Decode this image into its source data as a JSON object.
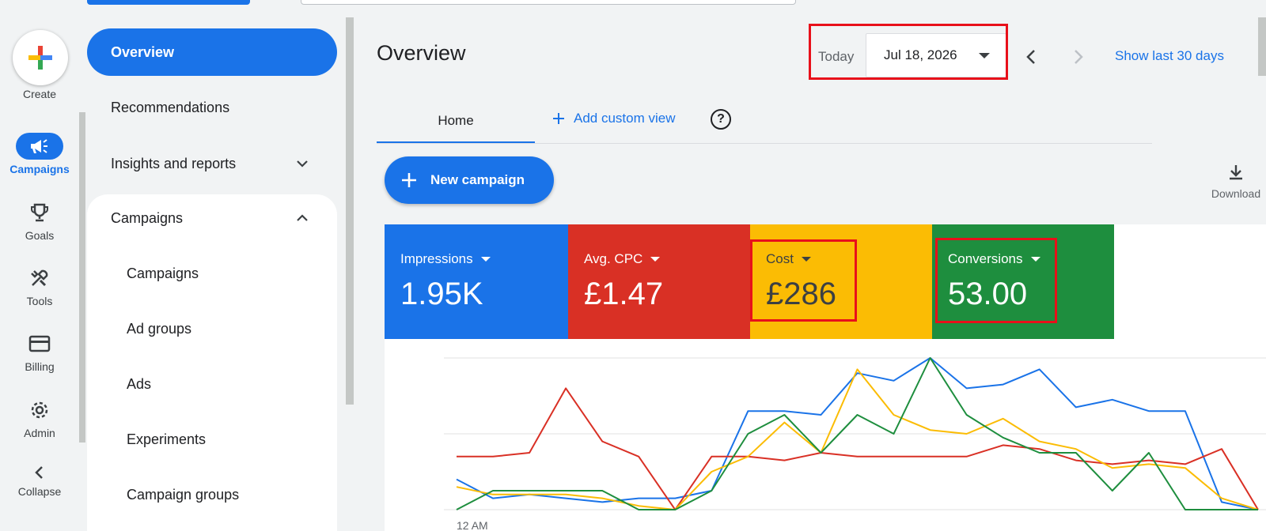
{
  "rail": {
    "create_label": "Create",
    "items": [
      {
        "label": "Campaigns",
        "icon": "megaphone-icon",
        "active": true
      },
      {
        "label": "Goals",
        "icon": "trophy-icon"
      },
      {
        "label": "Tools",
        "icon": "tools-icon"
      },
      {
        "label": "Billing",
        "icon": "credit-card-icon"
      },
      {
        "label": "Admin",
        "icon": "gear-icon"
      },
      {
        "label": "Collapse",
        "icon": "chevron-left-icon"
      }
    ]
  },
  "nav": {
    "overview": "Overview",
    "recommendations": "Recommendations",
    "insights": "Insights and reports",
    "campaigns_group": "Campaigns",
    "sub_items": [
      "Campaigns",
      "Ad groups",
      "Ads",
      "Experiments",
      "Campaign groups"
    ]
  },
  "header": {
    "title": "Overview",
    "today_label": "Today",
    "date_value": "Jul 18, 2026",
    "show_30": "Show last 30 days"
  },
  "tabs": {
    "home": "Home",
    "add_custom_view": "Add custom view"
  },
  "actions": {
    "new_campaign": "New campaign",
    "download": "Download"
  },
  "metrics": [
    {
      "label": "Impressions",
      "value": "1.95K",
      "color": "#1a73e8"
    },
    {
      "label": "Avg. CPC",
      "value": "£1.47",
      "color": "#d93025"
    },
    {
      "label": "Cost",
      "value": "£286",
      "color": "#fbbc04"
    },
    {
      "label": "Conversions",
      "value": "53.00",
      "color": "#1e8e3e"
    }
  ],
  "chart_data": {
    "type": "line",
    "x_tick_labels": [
      "12 AM"
    ],
    "grid": true,
    "series": [
      {
        "color": "#1a73e8",
        "values": [
          8,
          3,
          4,
          3,
          2,
          3,
          3,
          5,
          26,
          26,
          25,
          36,
          34,
          40,
          32,
          33,
          37,
          27,
          29,
          26,
          26,
          2,
          0
        ]
      },
      {
        "color": "#d93025",
        "values": [
          14,
          14,
          15,
          32,
          18,
          14,
          0,
          14,
          14,
          13,
          15,
          14,
          14,
          14,
          14,
          17,
          16,
          13,
          12,
          13,
          12,
          16,
          0
        ]
      },
      {
        "color": "#fbbc04",
        "values": [
          6,
          4,
          4,
          4,
          3,
          1,
          0,
          10,
          14,
          23,
          15,
          37,
          25,
          21,
          20,
          24,
          18,
          16,
          11,
          12,
          11,
          3,
          0
        ]
      },
      {
        "color": "#1e8e3e",
        "values": [
          0,
          5,
          5,
          5,
          5,
          0,
          0,
          5,
          20,
          25,
          15,
          25,
          20,
          40,
          25,
          19,
          15,
          15,
          5,
          15,
          0,
          0,
          0
        ]
      }
    ]
  }
}
